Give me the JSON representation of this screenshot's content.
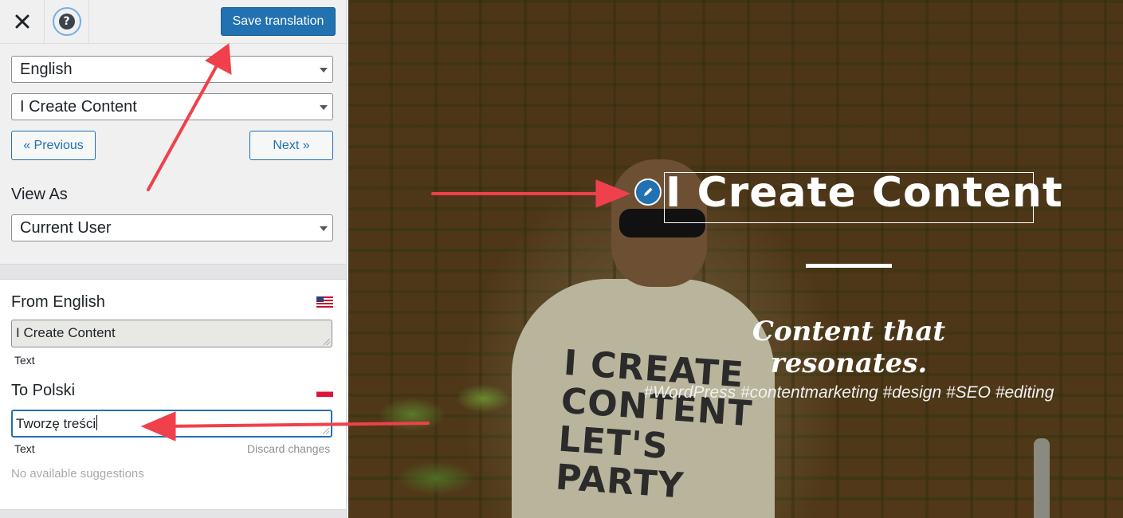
{
  "toolbar": {
    "close_icon": "close-icon",
    "help_icon": "help-icon",
    "help_glyph": "?",
    "save_label": "Save translation"
  },
  "selectors": {
    "language": "English",
    "string": "I Create Content",
    "view_as_label": "View As",
    "view_as": "Current User"
  },
  "nav": {
    "previous_label": "« Previous",
    "next_label": "Next »"
  },
  "translation": {
    "from_label": "From English",
    "from_flag": "us-flag-icon",
    "source_text": "I Create Content",
    "source_type": "Text",
    "to_label": "To Polski",
    "to_flag": "pl-flag-icon",
    "target_text": "Tworzę treści",
    "target_type": "Text",
    "discard_label": "Discard changes",
    "suggestions": "No available suggestions"
  },
  "preview": {
    "hero_title": "I Create Content",
    "tagline": "Content that resonates.",
    "hashtags": "#WordPress #contentmarketing #design #SEO #editing",
    "shirt_lines": [
      "I CREATE",
      "CONTENT",
      "LET'S",
      "PARTY"
    ],
    "edit_icon": "pencil-icon"
  },
  "colors": {
    "primary": "#2271b1",
    "annotation_arrow": "#f0404b",
    "panel_bg": "#f0f0f1"
  }
}
